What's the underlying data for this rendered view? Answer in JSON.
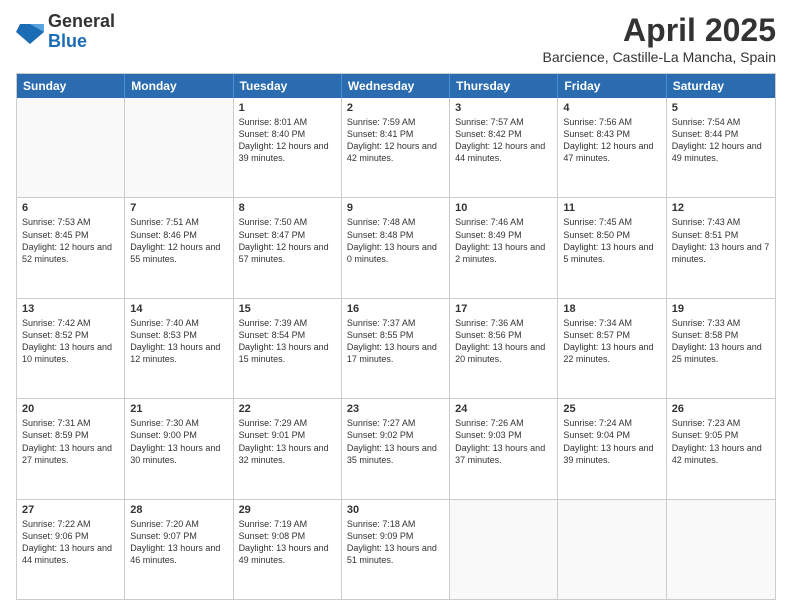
{
  "header": {
    "logo": {
      "general": "General",
      "blue": "Blue"
    },
    "month": "April 2025",
    "location": "Barcience, Castille-La Mancha, Spain"
  },
  "days": [
    "Sunday",
    "Monday",
    "Tuesday",
    "Wednesday",
    "Thursday",
    "Friday",
    "Saturday"
  ],
  "weeks": [
    [
      {
        "day": "",
        "content": ""
      },
      {
        "day": "",
        "content": ""
      },
      {
        "day": "1",
        "content": "Sunrise: 8:01 AM\nSunset: 8:40 PM\nDaylight: 12 hours and 39 minutes."
      },
      {
        "day": "2",
        "content": "Sunrise: 7:59 AM\nSunset: 8:41 PM\nDaylight: 12 hours and 42 minutes."
      },
      {
        "day": "3",
        "content": "Sunrise: 7:57 AM\nSunset: 8:42 PM\nDaylight: 12 hours and 44 minutes."
      },
      {
        "day": "4",
        "content": "Sunrise: 7:56 AM\nSunset: 8:43 PM\nDaylight: 12 hours and 47 minutes."
      },
      {
        "day": "5",
        "content": "Sunrise: 7:54 AM\nSunset: 8:44 PM\nDaylight: 12 hours and 49 minutes."
      }
    ],
    [
      {
        "day": "6",
        "content": "Sunrise: 7:53 AM\nSunset: 8:45 PM\nDaylight: 12 hours and 52 minutes."
      },
      {
        "day": "7",
        "content": "Sunrise: 7:51 AM\nSunset: 8:46 PM\nDaylight: 12 hours and 55 minutes."
      },
      {
        "day": "8",
        "content": "Sunrise: 7:50 AM\nSunset: 8:47 PM\nDaylight: 12 hours and 57 minutes."
      },
      {
        "day": "9",
        "content": "Sunrise: 7:48 AM\nSunset: 8:48 PM\nDaylight: 13 hours and 0 minutes."
      },
      {
        "day": "10",
        "content": "Sunrise: 7:46 AM\nSunset: 8:49 PM\nDaylight: 13 hours and 2 minutes."
      },
      {
        "day": "11",
        "content": "Sunrise: 7:45 AM\nSunset: 8:50 PM\nDaylight: 13 hours and 5 minutes."
      },
      {
        "day": "12",
        "content": "Sunrise: 7:43 AM\nSunset: 8:51 PM\nDaylight: 13 hours and 7 minutes."
      }
    ],
    [
      {
        "day": "13",
        "content": "Sunrise: 7:42 AM\nSunset: 8:52 PM\nDaylight: 13 hours and 10 minutes."
      },
      {
        "day": "14",
        "content": "Sunrise: 7:40 AM\nSunset: 8:53 PM\nDaylight: 13 hours and 12 minutes."
      },
      {
        "day": "15",
        "content": "Sunrise: 7:39 AM\nSunset: 8:54 PM\nDaylight: 13 hours and 15 minutes."
      },
      {
        "day": "16",
        "content": "Sunrise: 7:37 AM\nSunset: 8:55 PM\nDaylight: 13 hours and 17 minutes."
      },
      {
        "day": "17",
        "content": "Sunrise: 7:36 AM\nSunset: 8:56 PM\nDaylight: 13 hours and 20 minutes."
      },
      {
        "day": "18",
        "content": "Sunrise: 7:34 AM\nSunset: 8:57 PM\nDaylight: 13 hours and 22 minutes."
      },
      {
        "day": "19",
        "content": "Sunrise: 7:33 AM\nSunset: 8:58 PM\nDaylight: 13 hours and 25 minutes."
      }
    ],
    [
      {
        "day": "20",
        "content": "Sunrise: 7:31 AM\nSunset: 8:59 PM\nDaylight: 13 hours and 27 minutes."
      },
      {
        "day": "21",
        "content": "Sunrise: 7:30 AM\nSunset: 9:00 PM\nDaylight: 13 hours and 30 minutes."
      },
      {
        "day": "22",
        "content": "Sunrise: 7:29 AM\nSunset: 9:01 PM\nDaylight: 13 hours and 32 minutes."
      },
      {
        "day": "23",
        "content": "Sunrise: 7:27 AM\nSunset: 9:02 PM\nDaylight: 13 hours and 35 minutes."
      },
      {
        "day": "24",
        "content": "Sunrise: 7:26 AM\nSunset: 9:03 PM\nDaylight: 13 hours and 37 minutes."
      },
      {
        "day": "25",
        "content": "Sunrise: 7:24 AM\nSunset: 9:04 PM\nDaylight: 13 hours and 39 minutes."
      },
      {
        "day": "26",
        "content": "Sunrise: 7:23 AM\nSunset: 9:05 PM\nDaylight: 13 hours and 42 minutes."
      }
    ],
    [
      {
        "day": "27",
        "content": "Sunrise: 7:22 AM\nSunset: 9:06 PM\nDaylight: 13 hours and 44 minutes."
      },
      {
        "day": "28",
        "content": "Sunrise: 7:20 AM\nSunset: 9:07 PM\nDaylight: 13 hours and 46 minutes."
      },
      {
        "day": "29",
        "content": "Sunrise: 7:19 AM\nSunset: 9:08 PM\nDaylight: 13 hours and 49 minutes."
      },
      {
        "day": "30",
        "content": "Sunrise: 7:18 AM\nSunset: 9:09 PM\nDaylight: 13 hours and 51 minutes."
      },
      {
        "day": "",
        "content": ""
      },
      {
        "day": "",
        "content": ""
      },
      {
        "day": "",
        "content": ""
      }
    ]
  ]
}
